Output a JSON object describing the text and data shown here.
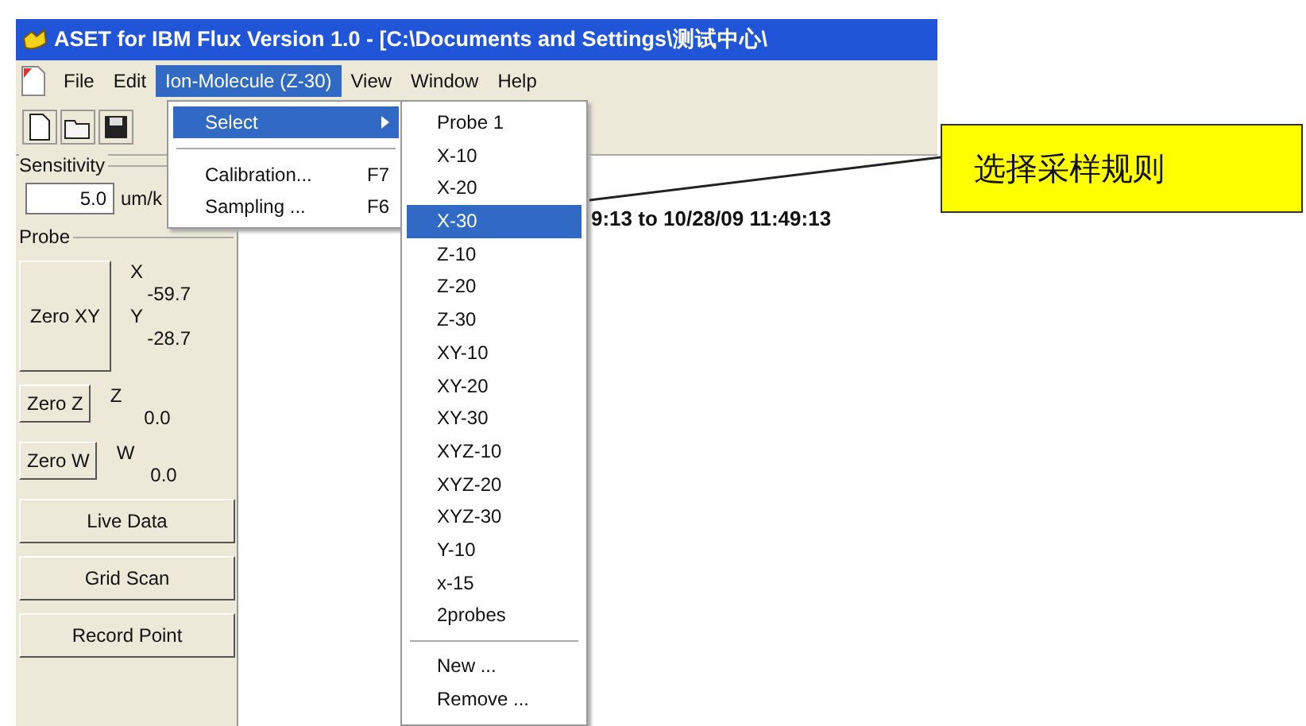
{
  "window": {
    "title": "ASET for IBM Flux Version 1.0 - [C:\\Documents and Settings\\测试中心\\"
  },
  "menu_bar": [
    {
      "label": "File",
      "selected": false
    },
    {
      "label": "Edit",
      "selected": false
    },
    {
      "label": "Ion-Molecule (Z-30)",
      "selected": true
    },
    {
      "label": "View",
      "selected": false
    },
    {
      "label": "Window",
      "selected": false
    },
    {
      "label": "Help",
      "selected": false
    }
  ],
  "sensitivity": {
    "label": "Sensitivity",
    "value": "5.0",
    "unit": "um/k"
  },
  "probe": {
    "label": "Probe",
    "rows": [
      {
        "button": "Zero XY",
        "readings": [
          {
            "axis": "X",
            "value": "-59.7"
          },
          {
            "axis": "Y",
            "value": "-28.7"
          }
        ]
      },
      {
        "button": "Zero Z",
        "readings": [
          {
            "axis": "Z",
            "value": "0.0"
          }
        ]
      },
      {
        "button": "Zero W",
        "readings": [
          {
            "axis": "W",
            "value": "0.0"
          }
        ]
      }
    ]
  },
  "actions": [
    "Live Data",
    "Grid Scan",
    "Record Point"
  ],
  "time_range": "9:13 to 10/28/09 11:49:13",
  "dropdown": {
    "items": [
      {
        "kind": "submenu",
        "label": "Select",
        "selected": true
      },
      {
        "kind": "separator"
      },
      {
        "kind": "item",
        "label": "Calibration...",
        "shortcut": "F7",
        "selected": false
      },
      {
        "kind": "item",
        "label": "Sampling ...",
        "shortcut": "F6",
        "selected": false
      }
    ]
  },
  "submenu": {
    "items": [
      {
        "kind": "item",
        "label": "Probe 1",
        "selected": false
      },
      {
        "kind": "item",
        "label": "X-10",
        "selected": false
      },
      {
        "kind": "item",
        "label": "X-20",
        "selected": false
      },
      {
        "kind": "item",
        "label": "X-30",
        "selected": true
      },
      {
        "kind": "item",
        "label": "Z-10",
        "selected": false
      },
      {
        "kind": "item",
        "label": "Z-20",
        "selected": false
      },
      {
        "kind": "item",
        "label": "Z-30",
        "selected": false
      },
      {
        "kind": "item",
        "label": "XY-10",
        "selected": false
      },
      {
        "kind": "item",
        "label": "XY-20",
        "selected": false
      },
      {
        "kind": "item",
        "label": "XY-30",
        "selected": false
      },
      {
        "kind": "item",
        "label": "XYZ-10",
        "selected": false
      },
      {
        "kind": "item",
        "label": "XYZ-20",
        "selected": false
      },
      {
        "kind": "item",
        "label": "XYZ-30",
        "selected": false
      },
      {
        "kind": "item",
        "label": "Y-10",
        "selected": false
      },
      {
        "kind": "item",
        "label": "x-15",
        "selected": false
      },
      {
        "kind": "item",
        "label": "2probes",
        "selected": false
      },
      {
        "kind": "separator"
      },
      {
        "kind": "item",
        "label": "New ...",
        "selected": false
      },
      {
        "kind": "item",
        "label": "Remove ...",
        "selected": false
      }
    ]
  },
  "callout": {
    "text": "选择采样规则"
  }
}
